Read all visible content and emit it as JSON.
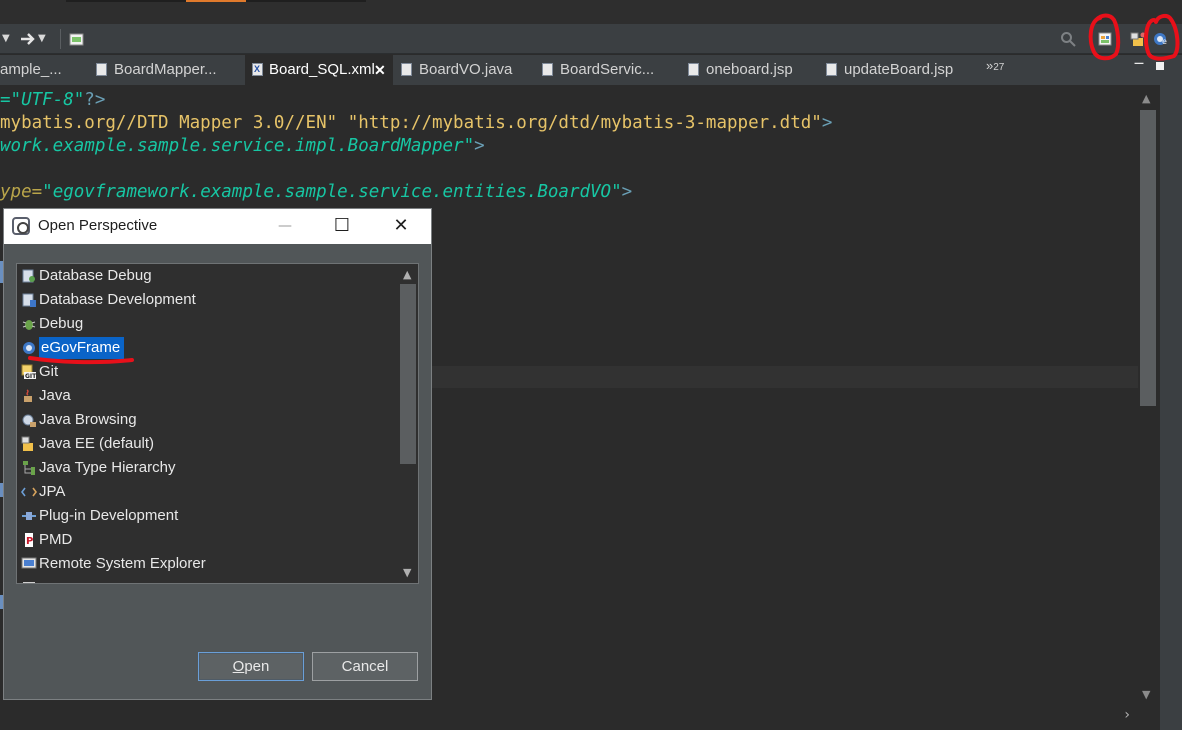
{
  "toolbar": {
    "back_icon": "back-arrow-icon",
    "forward_icon": "forward-arrow-icon",
    "search_icon": "search-icon",
    "open_perspective_icon": "open-perspective-icon",
    "javaee_icon": "javaee-perspective-icon",
    "egov_icon": "egovframe-perspective-icon"
  },
  "tabs": [
    {
      "label": "ample_..."
    },
    {
      "label": "BoardMapper..."
    },
    {
      "label": "Board_SQL.xml",
      "active": true
    },
    {
      "label": "BoardVO.java"
    },
    {
      "label": "BoardServic..."
    },
    {
      "label": "oneboard.jsp"
    },
    {
      "label": "updateBoard.jsp"
    }
  ],
  "tab_overflow": {
    "chevrons": "»",
    "count": "27"
  },
  "editor": {
    "line1": {
      "s1": "=\"UTF-8\"",
      "s2": "?>"
    },
    "line2": {
      "y1": "mybatis.org//DTD Mapper 3.0//EN\"",
      "y2": "\"http://mybatis.org/dtd/mybatis-3-mapper.dtd\"",
      "t": ">"
    },
    "line3": {
      "s1": "work.example.sample.service.impl.BoardMapper\"",
      "t": ">"
    },
    "line4": {
      "a": "ype=",
      "s1": "\"egovframework.example.sample.service.entities.BoardVO\"",
      "t": ">"
    }
  },
  "dialog": {
    "title": "Open Perspective",
    "minimize": "—",
    "maximize": "☐",
    "close": "✕",
    "items": [
      {
        "label": "Database Debug",
        "icon": "database-debug-icon"
      },
      {
        "label": "Database Development",
        "icon": "database-development-icon"
      },
      {
        "label": "Debug",
        "icon": "debug-bug-icon"
      },
      {
        "label": "eGovFrame",
        "icon": "egovframe-icon",
        "selected": true
      },
      {
        "label": "Git",
        "icon": "git-icon"
      },
      {
        "label": "Java",
        "icon": "java-icon"
      },
      {
        "label": "Java Browsing",
        "icon": "java-browsing-icon"
      },
      {
        "label": "Java EE (default)",
        "icon": "javaee-icon"
      },
      {
        "label": "Java Type Hierarchy",
        "icon": "type-hierarchy-icon"
      },
      {
        "label": "JPA",
        "icon": "jpa-icon"
      },
      {
        "label": "Plug-in Development",
        "icon": "plugin-icon"
      },
      {
        "label": "PMD",
        "icon": "pmd-icon"
      },
      {
        "label": "Remote System Explorer",
        "icon": "remote-system-icon"
      }
    ],
    "open_label": "Open",
    "cancel_label": "Cancel"
  },
  "colors": {
    "selection": "#0a64c8",
    "annotation": "#e8101a",
    "string": "#17c6a3",
    "doctype": "#e6c368"
  }
}
